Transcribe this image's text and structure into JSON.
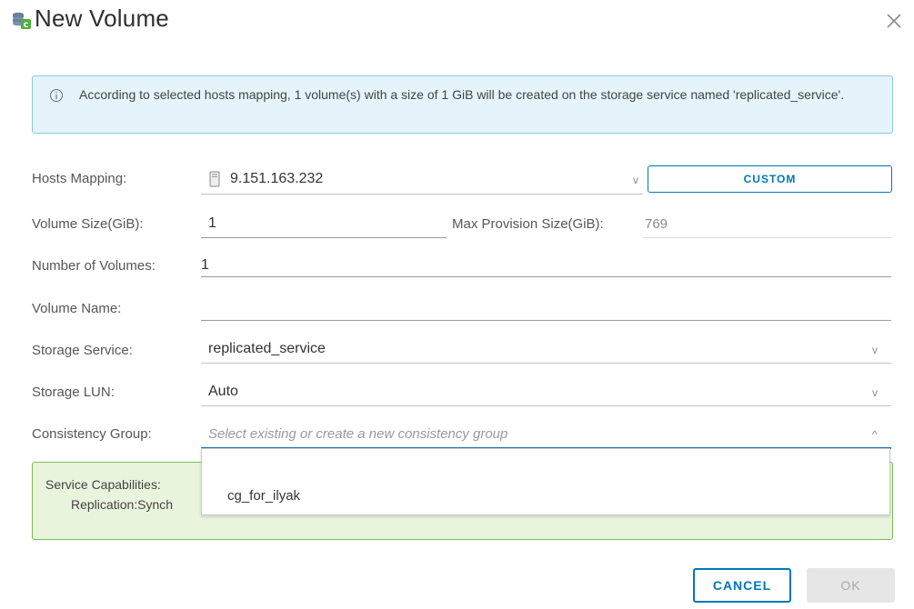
{
  "dialog": {
    "title": "New Volume",
    "close_icon": "close-icon",
    "title_icon": "storage-volume-icon"
  },
  "info": {
    "icon": "info-icon",
    "message": "According to selected hosts mapping, 1 volume(s) with a size of 1 GiB will be created on the storage service named 'replicated_service'."
  },
  "form": {
    "hosts_mapping": {
      "label": "Hosts Mapping:",
      "value": "9.151.163.232",
      "icon": "host-icon",
      "custom_label": "CUSTOM"
    },
    "volume_size": {
      "label": "Volume Size(GiB):",
      "value": "1"
    },
    "max_provision": {
      "label": "Max Provision Size(GiB):",
      "value": "769"
    },
    "number_of_volumes": {
      "label": "Number of Volumes:",
      "value": "1"
    },
    "volume_name": {
      "label": "Volume Name:",
      "value": ""
    },
    "storage_service": {
      "label": "Storage Service:",
      "value": "replicated_service"
    },
    "storage_lun": {
      "label": "Storage LUN:",
      "value": "Auto"
    },
    "consistency_group": {
      "label": "Consistency Group:",
      "placeholder": "Select existing or create a new consistency group",
      "options": [
        "cg_for_ilyak"
      ]
    }
  },
  "capabilities": {
    "line1": "Service Capabilities:",
    "line2": "Replication:Synch"
  },
  "footer": {
    "cancel_label": "CANCEL",
    "ok_label": "OK"
  },
  "colors": {
    "accent": "#0077b8",
    "info_bg": "#e5f4fb",
    "success_bg": "#e8f4dc"
  }
}
